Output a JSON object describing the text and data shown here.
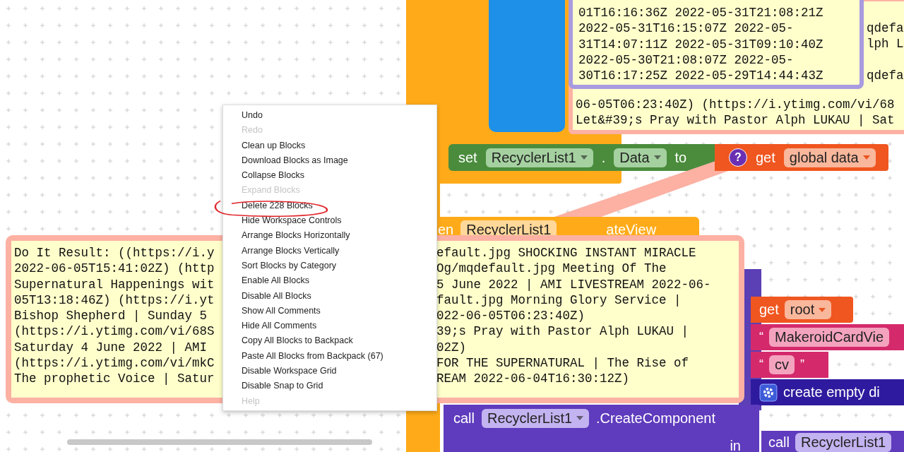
{
  "timestamp_comment": {
    "lines": [
      "01T16:16:36Z 2022-05-31T21:08:21Z",
      "2022-05-31T16:15:07Z 2022-05-",
      "31T14:07:11Z 2022-05-31T09:10:40Z",
      "2022-05-30T21:08:07Z 2022-05-",
      "30T16:17:25Z 2022-05-29T14:44:43Z"
    ]
  },
  "back_comment": {
    "side_lines": [
      "qdefa",
      "lph L",
      "qdefa"
    ],
    "lines": [
      "06-05T06:23:40Z) (https://i.ytimg.com/vi/68",
      "Let&#39;s Pray with Pastor Alph LUKAU | Sat"
    ]
  },
  "set_block": {
    "keyword": "set",
    "component": "RecyclerList1",
    "dot": ".",
    "property": "Data",
    "to": "to"
  },
  "get_block": {
    "help_icon": "?",
    "keyword": "get",
    "variable": "global data"
  },
  "event_block": {
    "prefix": "en",
    "component": "RecyclerList1",
    "suffix": "ateView"
  },
  "result_comment": {
    "lines": [
      {
        "left": "Do It Result: ((https://i.y",
        "right": "efault.jpg SHOCKING INSTANT MIRACLE"
      },
      {
        "left": "2022-06-05T15:41:02Z) (http",
        "right": "Og/mqdefault.jpg Meeting Of The"
      },
      {
        "left": "Supernatural Happenings wit",
        "right": "5 June 2022 | AMI LIVESTREAM 2022-06-"
      },
      {
        "left": "05T13:18:46Z) (https://i.yt",
        "right": "fault.jpg Morning Glory Service |"
      },
      {
        "left": "Bishop Shepherd | Sunday 5",
        "right": "022-06-05T06:23:40Z)"
      },
      {
        "left": "(https://i.ytimg.com/vi/68S",
        "right": "39;s Pray with Pastor Alph LUKAU |"
      },
      {
        "left": "Saturday 4 June 2022 | AMI",
        "right": "02Z)"
      },
      {
        "left": "(https://i.ytimg.com/vi/mkC",
        "right": "FOR THE SUPERNATURAL | The Rise of"
      },
      {
        "left": "The prophetic Voice | Satur",
        "right": "REAM 2022-06-04T16:30:12Z)"
      }
    ]
  },
  "socket_blocks": [
    {
      "kind": "get",
      "keyword": "get",
      "value": "root"
    },
    {
      "kind": "text",
      "open_quote": "“",
      "value": "MakeroidCardVie"
    },
    {
      "kind": "text",
      "open_quote": "“",
      "value": "cv",
      "close_quote": "”"
    },
    {
      "kind": "dictionary",
      "label": "create empty di"
    }
  ],
  "call_block": {
    "keyword": "call",
    "component": "RecyclerList1",
    "method": ".CreateComponent"
  },
  "in_label": "in",
  "call_block_2": {
    "keyword": "call",
    "component": "RecyclerList1"
  },
  "context_menu": {
    "items": [
      {
        "label": "Undo",
        "disabled": false
      },
      {
        "label": "Redo",
        "disabled": true
      },
      {
        "label": "Clean up Blocks",
        "disabled": false
      },
      {
        "label": "Download Blocks as Image",
        "disabled": false
      },
      {
        "label": "Collapse Blocks",
        "disabled": false
      },
      {
        "label": "Expand Blocks",
        "disabled": true
      },
      {
        "label": "Delete 228 Blocks",
        "disabled": false
      },
      {
        "label": "Hide Workspace Controls",
        "disabled": false
      },
      {
        "label": "Arrange Blocks Horizontally",
        "disabled": false
      },
      {
        "label": "Arrange Blocks Vertically",
        "disabled": false
      },
      {
        "label": "Sort Blocks by Category",
        "disabled": false
      },
      {
        "label": "Enable All Blocks",
        "disabled": false
      },
      {
        "label": "Disable All Blocks",
        "disabled": false
      },
      {
        "label": "Show All Comments",
        "disabled": false
      },
      {
        "label": "Hide All Comments",
        "disabled": false
      },
      {
        "label": "Copy All Blocks to Backpack",
        "disabled": false
      },
      {
        "label": "Paste All Blocks from Backpack (67)",
        "disabled": false
      },
      {
        "label": "Disable Workspace Grid",
        "disabled": false
      },
      {
        "label": "Disable Snap to Grid",
        "disabled": false
      },
      {
        "label": "Help",
        "disabled": true
      }
    ]
  }
}
